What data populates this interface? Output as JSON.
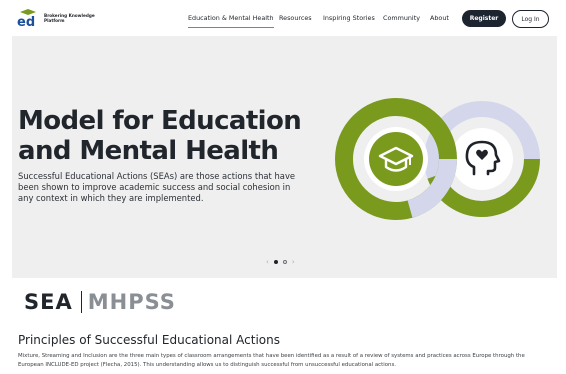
{
  "header": {
    "logo": {
      "mark": "ed",
      "text": "Brokering Knowledge Platform"
    },
    "nav": [
      {
        "label": "Education & Mental Health",
        "active": true
      },
      {
        "label": "Resources",
        "active": false
      },
      {
        "label": "Inspiring Stories",
        "active": false
      },
      {
        "label": "Community",
        "active": false
      },
      {
        "label": "About",
        "active": false
      }
    ],
    "register_label": "Register",
    "login_label": "Log In"
  },
  "hero": {
    "title": "Model for Education and Mental Health",
    "description": "Successful Educational Actions (SEAs) are those actions that have been shown to improve academic success and social cohesion in any context in which they are implemented.",
    "graphic": {
      "left_icon": "graduation-cap-icon",
      "right_icon": "head-heart-icon"
    },
    "carousel": {
      "prev": "‹",
      "next": "›",
      "slides": 2,
      "current": 1
    }
  },
  "tabs": [
    {
      "label": "SEA",
      "active": true
    },
    {
      "label": "MHPSS",
      "active": false
    }
  ],
  "section": {
    "title": "Principles of Successful Educational Actions",
    "body": "Mixture, Streaming and Inclusion are the three main types of classroom arrangements that have been identified as a result of a review of systems and practices across Europe through the European INCLUDE-ED project (Flecha, 2015). This understanding allows us to distinguish successful from unsuccessful educational actions."
  },
  "colors": {
    "accent_green": "#7a9a1e",
    "lavender": "#d4d7ec",
    "navy": "#1c2430",
    "hero_bg": "#efefef"
  }
}
